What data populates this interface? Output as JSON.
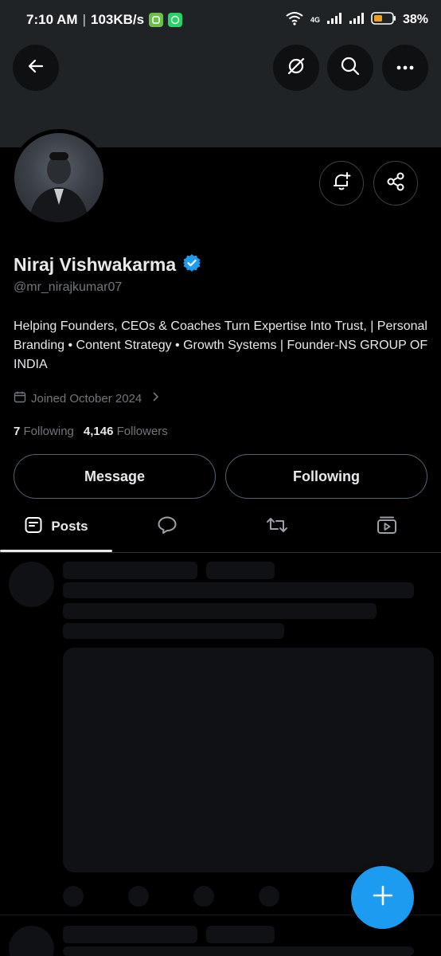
{
  "status_bar": {
    "time": "7:10 AM",
    "speed": "103KB/s",
    "network": "4G",
    "battery": "38%"
  },
  "profile": {
    "name": "Niraj Vishwakarma",
    "handle": "@mr_nirajkumar07",
    "bio": "Helping Founders, CEOs & Coaches Turn Expertise Into Trust, | Personal Branding • Content Strategy • Growth Systems | Founder-NS GROUP OF INDIA",
    "joined": "Joined October 2024",
    "following_count": "7",
    "following_label": "Following",
    "followers_count": "4,146",
    "followers_label": "Followers",
    "verified_color": "#1d9bf0"
  },
  "actions": {
    "message_label": "Message",
    "following_label": "Following"
  },
  "tabs": [
    {
      "label": "Posts",
      "icon": "posts-icon",
      "active": true
    },
    {
      "label": "",
      "icon": "replies-icon",
      "active": false
    },
    {
      "label": "",
      "icon": "reposts-icon",
      "active": false
    },
    {
      "label": "",
      "icon": "media-icon",
      "active": false
    }
  ],
  "header_icons": [
    "back-arrow-icon",
    "grok-icon",
    "search-icon",
    "more-icon"
  ],
  "accent_color": "#1d9bf0"
}
